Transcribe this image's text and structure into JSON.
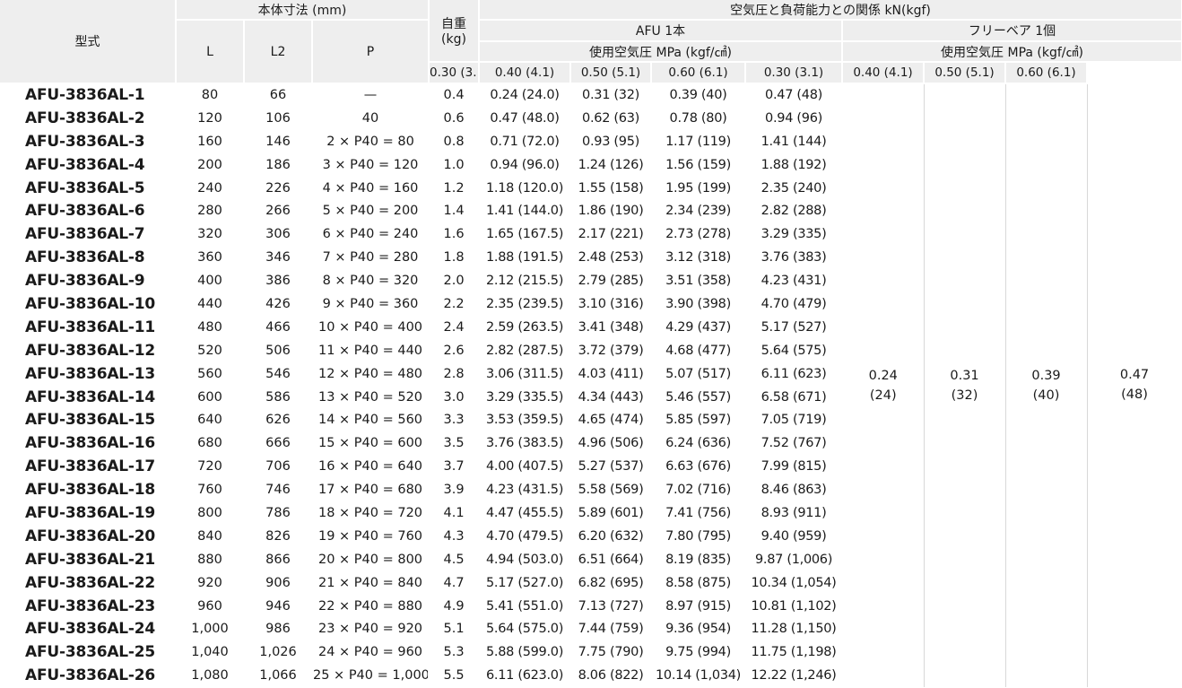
{
  "header": {
    "model": "型式",
    "dims_group": "本体寸法 (mm)",
    "dim_l": "L",
    "dim_l2": "L2",
    "dim_p": "P",
    "weight_line1": "自重",
    "weight_line2": "(kg)",
    "relation": "空気圧と負荷能力との関係 kN(kgf)",
    "afu_group": "AFU 1本",
    "free_group": "フリーベア 1個",
    "pressure_afu": "使用空気圧 MPa (kgf/㎠)",
    "pressure_free": "使用空気圧 MPa (kgf/㎠)",
    "pressures": [
      "0.30 (3.1)",
      "0.40 (4.1)",
      "0.50 (5.1)",
      "0.60 (6.1)"
    ]
  },
  "rows": [
    {
      "model": "AFU-3836AL-1",
      "l": "80",
      "l2": "66",
      "p": "—",
      "kg": "0.4",
      "a1": "0.24 (24.0)",
      "a2": "0.31 (32)",
      "a3": "0.39 (40)",
      "a4": "0.47 (48)"
    },
    {
      "model": "AFU-3836AL-2",
      "l": "120",
      "l2": "106",
      "p": "40",
      "kg": "0.6",
      "a1": "0.47 (48.0)",
      "a2": "0.62 (63)",
      "a3": "0.78 (80)",
      "a4": "0.94 (96)"
    },
    {
      "model": "AFU-3836AL-3",
      "l": "160",
      "l2": "146",
      "p": "2 × P40 = 80",
      "kg": "0.8",
      "a1": "0.71 (72.0)",
      "a2": "0.93 (95)",
      "a3": "1.17 (119)",
      "a4": "1.41 (144)"
    },
    {
      "model": "AFU-3836AL-4",
      "l": "200",
      "l2": "186",
      "p": "3 × P40 = 120",
      "kg": "1.0",
      "a1": "0.94 (96.0)",
      "a2": "1.24 (126)",
      "a3": "1.56 (159)",
      "a4": "1.88 (192)"
    },
    {
      "model": "AFU-3836AL-5",
      "l": "240",
      "l2": "226",
      "p": "4 × P40 = 160",
      "kg": "1.2",
      "a1": "1.18 (120.0)",
      "a2": "1.55 (158)",
      "a3": "1.95 (199)",
      "a4": "2.35 (240)"
    },
    {
      "model": "AFU-3836AL-6",
      "l": "280",
      "l2": "266",
      "p": "5 × P40 = 200",
      "kg": "1.4",
      "a1": "1.41 (144.0)",
      "a2": "1.86 (190)",
      "a3": "2.34 (239)",
      "a4": "2.82 (288)"
    },
    {
      "model": "AFU-3836AL-7",
      "l": "320",
      "l2": "306",
      "p": "6 × P40 = 240",
      "kg": "1.6",
      "a1": "1.65 (167.5)",
      "a2": "2.17 (221)",
      "a3": "2.73 (278)",
      "a4": "3.29 (335)"
    },
    {
      "model": "AFU-3836AL-8",
      "l": "360",
      "l2": "346",
      "p": "7 × P40 = 280",
      "kg": "1.8",
      "a1": "1.88 (191.5)",
      "a2": "2.48 (253)",
      "a3": "3.12 (318)",
      "a4": "3.76 (383)"
    },
    {
      "model": "AFU-3836AL-9",
      "l": "400",
      "l2": "386",
      "p": "8 × P40 = 320",
      "kg": "2.0",
      "a1": "2.12 (215.5)",
      "a2": "2.79 (285)",
      "a3": "3.51 (358)",
      "a4": "4.23 (431)"
    },
    {
      "model": "AFU-3836AL-10",
      "l": "440",
      "l2": "426",
      "p": "9 × P40 = 360",
      "kg": "2.2",
      "a1": "2.35 (239.5)",
      "a2": "3.10 (316)",
      "a3": "3.90 (398)",
      "a4": "4.70 (479)"
    },
    {
      "model": "AFU-3836AL-11",
      "l": "480",
      "l2": "466",
      "p": "10 × P40 = 400",
      "kg": "2.4",
      "a1": "2.59 (263.5)",
      "a2": "3.41 (348)",
      "a3": "4.29 (437)",
      "a4": "5.17 (527)"
    },
    {
      "model": "AFU-3836AL-12",
      "l": "520",
      "l2": "506",
      "p": "11 × P40 = 440",
      "kg": "2.6",
      "a1": "2.82 (287.5)",
      "a2": "3.72 (379)",
      "a3": "4.68 (477)",
      "a4": "5.64 (575)"
    },
    {
      "model": "AFU-3836AL-13",
      "l": "560",
      "l2": "546",
      "p": "12 × P40 = 480",
      "kg": "2.8",
      "a1": "3.06 (311.5)",
      "a2": "4.03 (411)",
      "a3": "5.07 (517)",
      "a4": "6.11 (623)"
    },
    {
      "model": "AFU-3836AL-14",
      "l": "600",
      "l2": "586",
      "p": "13 × P40 = 520",
      "kg": "3.0",
      "a1": "3.29 (335.5)",
      "a2": "4.34 (443)",
      "a3": "5.46 (557)",
      "a4": "6.58 (671)"
    },
    {
      "model": "AFU-3836AL-15",
      "l": "640",
      "l2": "626",
      "p": "14 × P40 = 560",
      "kg": "3.3",
      "a1": "3.53 (359.5)",
      "a2": "4.65 (474)",
      "a3": "5.85 (597)",
      "a4": "7.05 (719)"
    },
    {
      "model": "AFU-3836AL-16",
      "l": "680",
      "l2": "666",
      "p": "15 × P40 = 600",
      "kg": "3.5",
      "a1": "3.76 (383.5)",
      "a2": "4.96 (506)",
      "a3": "6.24 (636)",
      "a4": "7.52 (767)"
    },
    {
      "model": "AFU-3836AL-17",
      "l": "720",
      "l2": "706",
      "p": "16 × P40 = 640",
      "kg": "3.7",
      "a1": "4.00 (407.5)",
      "a2": "5.27 (537)",
      "a3": "6.63 (676)",
      "a4": "7.99 (815)"
    },
    {
      "model": "AFU-3836AL-18",
      "l": "760",
      "l2": "746",
      "p": "17 × P40 = 680",
      "kg": "3.9",
      "a1": "4.23 (431.5)",
      "a2": "5.58 (569)",
      "a3": "7.02 (716)",
      "a4": "8.46 (863)"
    },
    {
      "model": "AFU-3836AL-19",
      "l": "800",
      "l2": "786",
      "p": "18 × P40 = 720",
      "kg": "4.1",
      "a1": "4.47 (455.5)",
      "a2": "5.89 (601)",
      "a3": "7.41 (756)",
      "a4": "8.93 (911)"
    },
    {
      "model": "AFU-3836AL-20",
      "l": "840",
      "l2": "826",
      "p": "19 × P40 = 760",
      "kg": "4.3",
      "a1": "4.70 (479.5)",
      "a2": "6.20 (632)",
      "a3": "7.80 (795)",
      "a4": "9.40 (959)"
    },
    {
      "model": "AFU-3836AL-21",
      "l": "880",
      "l2": "866",
      "p": "20 × P40 = 800",
      "kg": "4.5",
      "a1": "4.94 (503.0)",
      "a2": "6.51 (664)",
      "a3": "8.19 (835)",
      "a4": "9.87 (1,006)"
    },
    {
      "model": "AFU-3836AL-22",
      "l": "920",
      "l2": "906",
      "p": "21 × P40 = 840",
      "kg": "4.7",
      "a1": "5.17 (527.0)",
      "a2": "6.82 (695)",
      "a3": "8.58 (875)",
      "a4": "10.34 (1,054)"
    },
    {
      "model": "AFU-3836AL-23",
      "l": "960",
      "l2": "946",
      "p": "22 × P40 = 880",
      "kg": "4.9",
      "a1": "5.41 (551.0)",
      "a2": "7.13 (727)",
      "a3": "8.97 (915)",
      "a4": "10.81 (1,102)"
    },
    {
      "model": "AFU-3836AL-24",
      "l": "1,000",
      "l2": "986",
      "p": "23 × P40 = 920",
      "kg": "5.1",
      "a1": "5.64 (575.0)",
      "a2": "7.44 (759)",
      "a3": "9.36 (954)",
      "a4": "11.28 (1,150)"
    },
    {
      "model": "AFU-3836AL-25",
      "l": "1,040",
      "l2": "1,026",
      "p": "24 × P40 = 960",
      "kg": "5.3",
      "a1": "5.88 (599.0)",
      "a2": "7.75 (790)",
      "a3": "9.75 (994)",
      "a4": "11.75 (1,198)"
    },
    {
      "model": "AFU-3836AL-26",
      "l": "1,080",
      "l2": "1,066",
      "p": "25 × P40 = 1,000",
      "kg": "5.5",
      "a1": "6.11 (623.0)",
      "a2": "8.06 (822)",
      "a3": "10.14 (1,034)",
      "a4": "12.22 (1,246)"
    }
  ],
  "free_bearing": [
    {
      "value": "0.24",
      "kgf": "(24)"
    },
    {
      "value": "0.31",
      "kgf": "(32)"
    },
    {
      "value": "0.39",
      "kgf": "(40)"
    },
    {
      "value": "0.47",
      "kgf": "(48)"
    }
  ]
}
